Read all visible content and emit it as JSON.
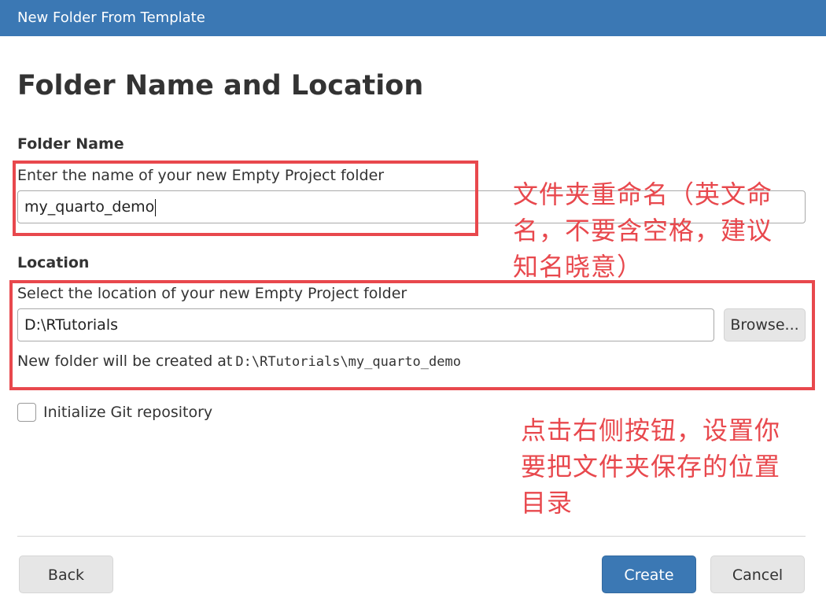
{
  "window": {
    "title": "New Folder From Template"
  },
  "page": {
    "heading": "Folder Name and Location"
  },
  "folder_name": {
    "section_label": "Folder Name",
    "prompt": "Enter the name of your new Empty Project folder",
    "value": "my_quarto_demo"
  },
  "location": {
    "section_label": "Location",
    "prompt": "Select the location of your new Empty Project folder",
    "value": "D:\\RTutorials",
    "browse_label": "Browse...",
    "created_at_prefix": "New folder will be created at",
    "created_at_path": "D:\\RTutorials\\my_quarto_demo"
  },
  "git": {
    "label": "Initialize Git repository",
    "checked": false
  },
  "footer": {
    "back_label": "Back",
    "create_label": "Create",
    "cancel_label": "Cancel"
  },
  "annotations": {
    "rename_note": "文件夹重命名（英文命\n名，不要含空格，建议\n知名晓意）",
    "location_note": "点击右侧按钮，设置你\n要把文件夹保存的位置\n目录"
  },
  "colors": {
    "accent": "#3b78b4",
    "annotation_red": "#e8484d"
  }
}
